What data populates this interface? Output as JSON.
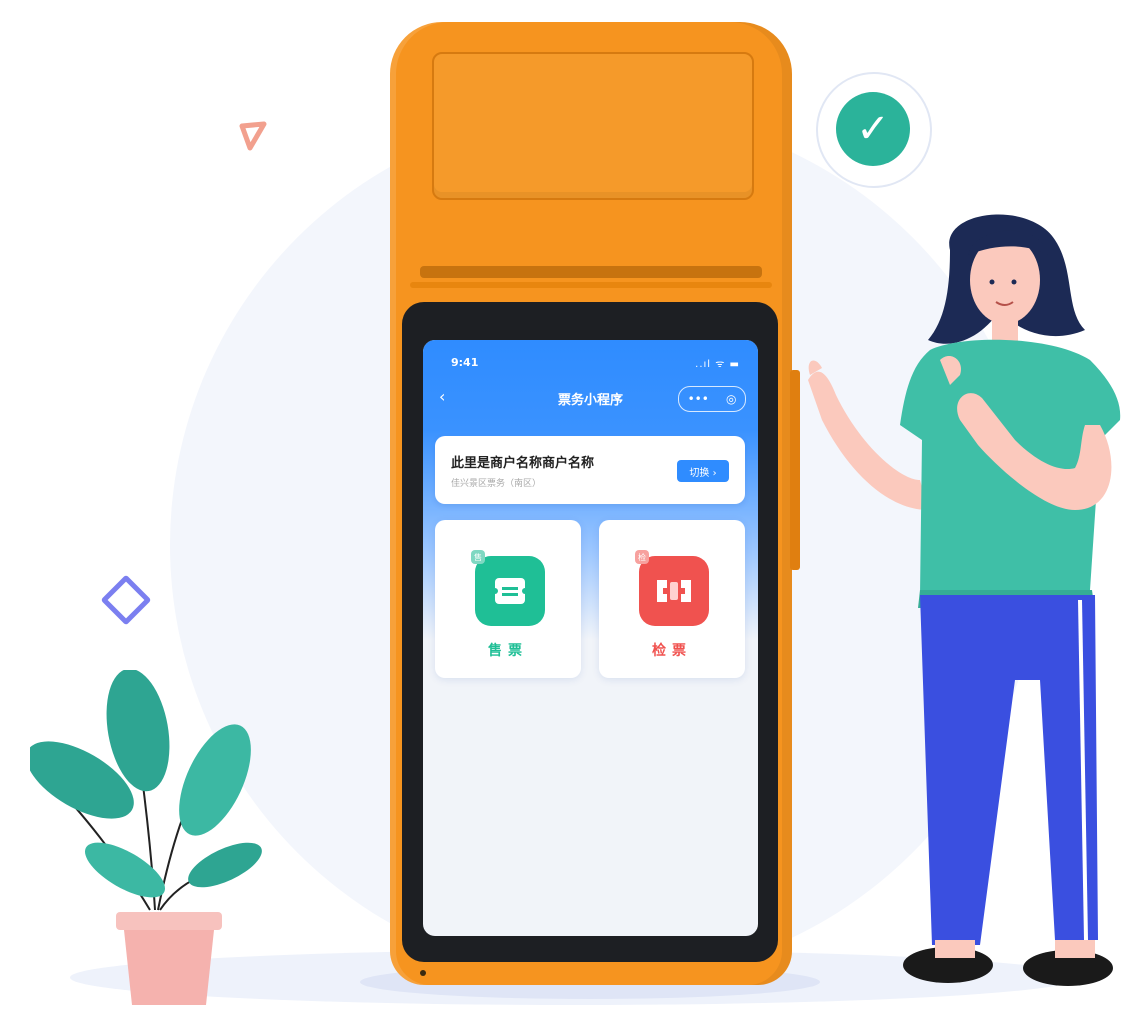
{
  "colors": {
    "device": "#f6941f",
    "screen_blue": "#2f8cff",
    "check_green": "#2bb39a",
    "sell_green": "#1fbf96",
    "check_red": "#f0524f",
    "shirt": "#3fbfa7",
    "pants": "#3a4fe0",
    "pot": "#f5b2ae",
    "leaf": "#2ea592"
  },
  "screen": {
    "status_time": "9:41",
    "status_icons": "..ıl ᯤ ▬",
    "title": "票务小程序",
    "back_glyph": "‹",
    "capsule_dots": "•••",
    "capsule_target": "◎",
    "merchant": {
      "name": "此里是商户名称商户名称",
      "sub": "佳兴景区票务（南区）",
      "switch_label": "切换 ›"
    },
    "functions": [
      {
        "label": "售票",
        "badge": "售",
        "icon": "ticket-icon"
      },
      {
        "label": "检票",
        "badge": "检",
        "icon": "scan-icon"
      }
    ]
  },
  "decorations": {
    "check": "✓"
  }
}
